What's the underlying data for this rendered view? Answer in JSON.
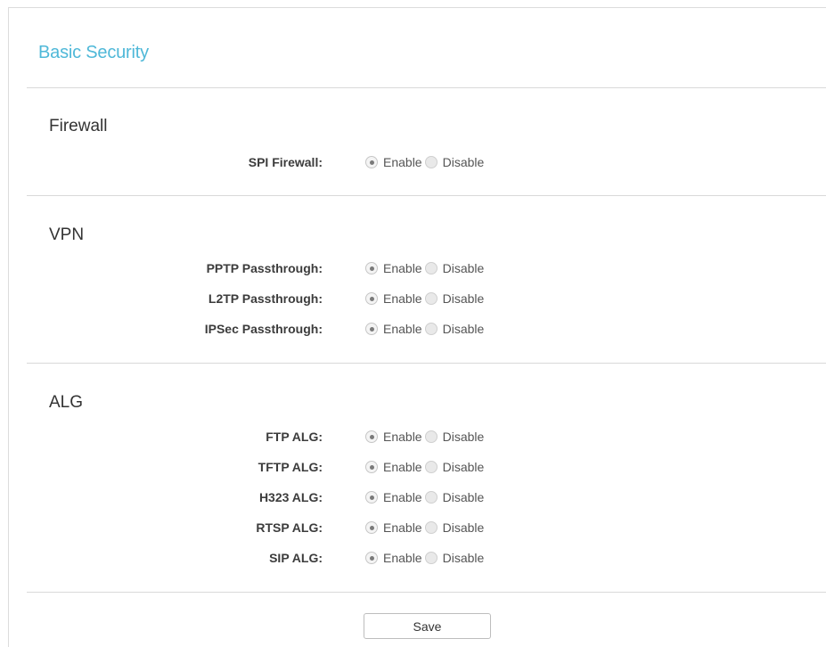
{
  "page": {
    "title": "Basic Security"
  },
  "radio_labels": {
    "enable": "Enable",
    "disable": "Disable"
  },
  "sections": {
    "firewall": {
      "title": "Firewall",
      "items": [
        {
          "label": "SPI Firewall:",
          "value": "Enable"
        }
      ]
    },
    "vpn": {
      "title": "VPN",
      "items": [
        {
          "label": "PPTP Passthrough:",
          "value": "Enable"
        },
        {
          "label": "L2TP Passthrough:",
          "value": "Enable"
        },
        {
          "label": "IPSec Passthrough:",
          "value": "Enable"
        }
      ]
    },
    "alg": {
      "title": "ALG",
      "items": [
        {
          "label": "FTP ALG:",
          "value": "Enable"
        },
        {
          "label": "TFTP ALG:",
          "value": "Enable"
        },
        {
          "label": "H323 ALG:",
          "value": "Enable"
        },
        {
          "label": "RTSP ALG:",
          "value": "Enable"
        },
        {
          "label": "SIP ALG:",
          "value": "Enable"
        }
      ]
    }
  },
  "actions": {
    "save_label": "Save"
  },
  "colors": {
    "title_accent": "#4fb8d8"
  }
}
